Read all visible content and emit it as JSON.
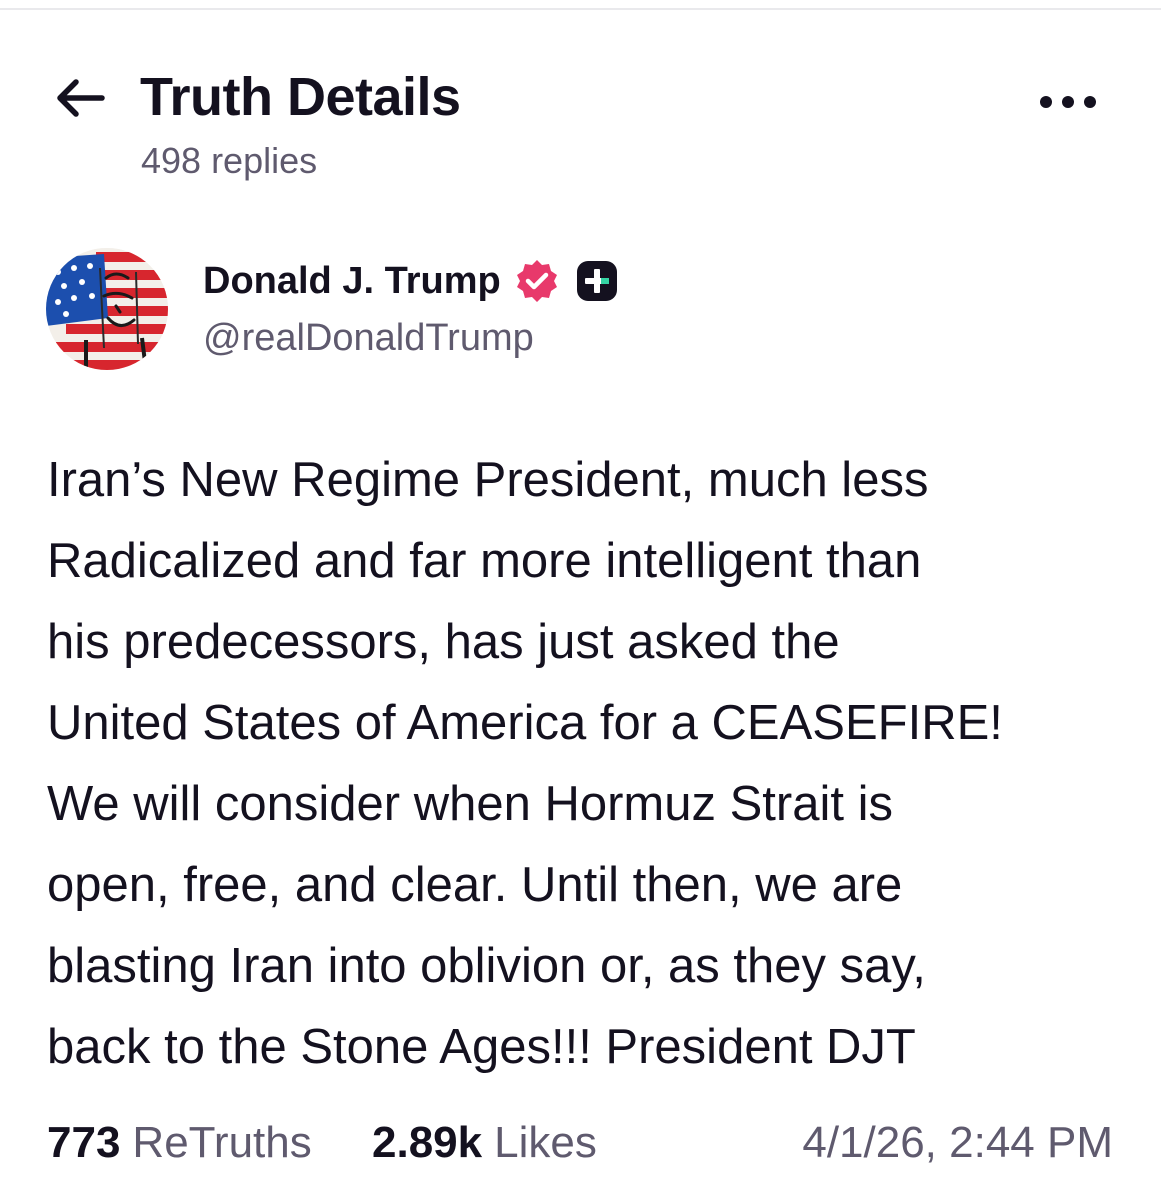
{
  "header": {
    "title": "Truth Details",
    "replies": "498 replies"
  },
  "author": {
    "name": "Donald J. Trump",
    "handle": "@realDonaldTrump",
    "verified_color": "#e8396b",
    "badge_color": "#14111f",
    "badge_accent": "#35d4a4",
    "badge_icon": "plus-badge-icon",
    "verified_icon": "verified-badge-icon",
    "avatar_icon": "american-flag-portrait-avatar"
  },
  "post": {
    "lines": [
      "Iran’s New Regime President, much less",
      "Radicalized and far more intelligent than",
      "his predecessors, has just asked the",
      "United States of America for a CEASEFIRE!",
      "We will consider when Hormuz Strait is",
      "open, free, and clear. Until then, we are",
      "blasting Iran into oblivion or, as they say,",
      "back to the Stone Ages!!! President DJT"
    ]
  },
  "stats": {
    "retruths_count": "773",
    "retruths_label": "ReTruths",
    "likes_count": "2.89k",
    "likes_label": "Likes",
    "timestamp": "4/1/26, 2:44 PM"
  }
}
